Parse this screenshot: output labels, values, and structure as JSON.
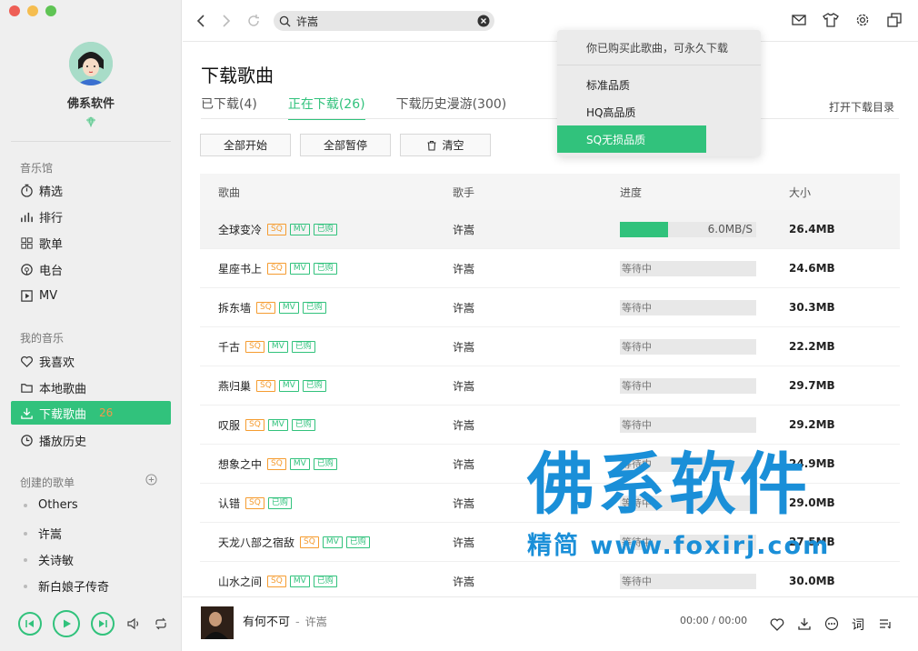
{
  "window": {
    "traffic_colors": [
      "#ee5e55",
      "#f5bd4f",
      "#5fc454"
    ]
  },
  "user": {
    "name": "佛系软件"
  },
  "sidebar": {
    "music_hall_label": "音乐馆",
    "music_hall_items": [
      {
        "label": "精选",
        "icon": "stopwatch-icon"
      },
      {
        "label": "排行",
        "icon": "bar-chart-icon"
      },
      {
        "label": "歌单",
        "icon": "grid-icon"
      },
      {
        "label": "电台",
        "icon": "radio-icon"
      },
      {
        "label": "MV",
        "icon": "play-box-icon"
      }
    ],
    "my_music_label": "我的音乐",
    "my_music_items": [
      {
        "label": "我喜欢",
        "icon": "heart-icon"
      },
      {
        "label": "本地歌曲",
        "icon": "folder-icon"
      },
      {
        "label": "下载歌曲",
        "icon": "download-icon",
        "count": "26",
        "active": true
      },
      {
        "label": "播放历史",
        "icon": "clock-icon"
      }
    ],
    "created_label": "创建的歌单",
    "playlists": [
      "Others",
      "许嵩",
      "关诗敏",
      "新白娘子传奇"
    ]
  },
  "search": {
    "value": "许嵩"
  },
  "page": {
    "title": "下载歌曲",
    "open_dir": "打开下载目录"
  },
  "tabs": [
    {
      "label": "已下载(4)"
    },
    {
      "label": "正在下载(26)",
      "active": true
    },
    {
      "label": "下载历史漫游(300)"
    }
  ],
  "actions": {
    "start_all": "全部开始",
    "pause_all": "全部暂停",
    "clear": "清空"
  },
  "table": {
    "headers": [
      "歌曲",
      "歌手",
      "进度",
      "大小"
    ],
    "rows": [
      {
        "song": "全球变冷",
        "tags": [
          "SQ",
          "MV",
          "已购"
        ],
        "artist": "许嵩",
        "progress": 0.35,
        "speed": "6.0MB/S",
        "size": "26.4MB"
      },
      {
        "song": "星座书上",
        "tags": [
          "SQ",
          "MV",
          "已购"
        ],
        "artist": "许嵩",
        "status": "等待中",
        "size": "24.6MB"
      },
      {
        "song": "拆东墙",
        "tags": [
          "SQ",
          "MV",
          "已购"
        ],
        "artist": "许嵩",
        "status": "等待中",
        "size": "30.3MB"
      },
      {
        "song": "千古",
        "tags": [
          "SQ",
          "MV",
          "已购"
        ],
        "artist": "许嵩",
        "status": "等待中",
        "size": "22.2MB"
      },
      {
        "song": "燕归巢",
        "tags": [
          "SQ",
          "MV",
          "已购"
        ],
        "artist": "许嵩",
        "status": "等待中",
        "size": "29.7MB"
      },
      {
        "song": "叹服",
        "tags": [
          "SQ",
          "MV",
          "已购"
        ],
        "artist": "许嵩",
        "status": "等待中",
        "size": "29.2MB"
      },
      {
        "song": "想象之中",
        "tags": [
          "SQ",
          "MV",
          "已购"
        ],
        "artist": "许嵩",
        "status": "等待中",
        "size": "24.9MB"
      },
      {
        "song": "认错",
        "tags": [
          "SQ",
          "已购"
        ],
        "artist": "许嵩",
        "status": "等待中",
        "size": "29.0MB"
      },
      {
        "song": "天龙八部之宿敌",
        "tags": [
          "SQ",
          "MV",
          "已购"
        ],
        "artist": "许嵩",
        "status": "等待中",
        "size": "27.5MB"
      },
      {
        "song": "山水之间",
        "tags": [
          "SQ",
          "MV",
          "已购"
        ],
        "artist": "许嵩",
        "status": "等待中",
        "size": "30.0MB"
      }
    ]
  },
  "popup": {
    "header": "你已购买此歌曲，可永久下载",
    "options": [
      "标准品质",
      "HQ高品质",
      "SQ无损品质"
    ],
    "selected": 2
  },
  "now_playing": {
    "title": "有何不可",
    "sep": "-",
    "artist": "许嵩",
    "time": "00:00 / 00:00",
    "lyric_label": "词"
  },
  "watermark": {
    "line1": "佛系软件",
    "line2": "精简 www.foxirj.com"
  },
  "colors": {
    "accent": "#31c27c",
    "sq": "#f59c30"
  }
}
